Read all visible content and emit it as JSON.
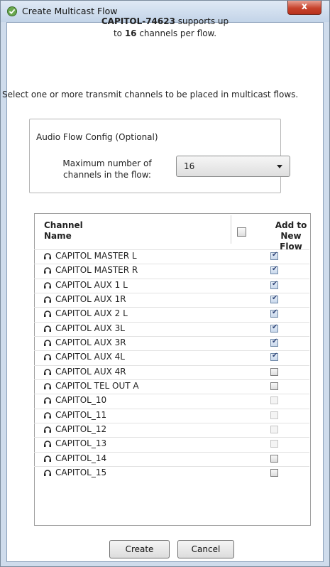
{
  "window": {
    "title": "Create Multicast Flow",
    "close_label": "x"
  },
  "header": {
    "device": "CAPITOL-74623",
    "line1_rest": " supports up",
    "line2_prefix": "to ",
    "max_channels": "16",
    "line2_suffix": " channels per flow."
  },
  "instruction": "Select one or more transmit channels to be placed in multicast flows.",
  "audio_flow_config": {
    "legend": "Audio Flow Config (Optional)",
    "max_label_line1": "Maximum number of",
    "max_label_line2": "channels in the flow:",
    "selected_value": "16"
  },
  "table": {
    "col_name_line1": "Channel",
    "col_name_line2": "Name",
    "col_add_line1": "Add to",
    "col_add_line2": "New Flow",
    "rows": [
      {
        "name": "CAPITOL MASTER L",
        "checked": true,
        "enabled": true
      },
      {
        "name": "CAPITOL MASTER R",
        "checked": true,
        "enabled": true
      },
      {
        "name": "CAPITOL AUX 1 L",
        "checked": true,
        "enabled": true
      },
      {
        "name": "CAPITOL AUX 1R",
        "checked": true,
        "enabled": true
      },
      {
        "name": "CAPITOL AUX 2 L",
        "checked": true,
        "enabled": true
      },
      {
        "name": "CAPITOL AUX 3L",
        "checked": true,
        "enabled": true
      },
      {
        "name": "CAPITOL AUX 3R",
        "checked": true,
        "enabled": true
      },
      {
        "name": "CAPITOL AUX 4L",
        "checked": true,
        "enabled": true
      },
      {
        "name": "CAPITOL AUX 4R",
        "checked": false,
        "enabled": true
      },
      {
        "name": "CAPITOL TEL OUT A",
        "checked": false,
        "enabled": true
      },
      {
        "name": "CAPITOL_10",
        "checked": false,
        "enabled": false
      },
      {
        "name": "CAPITOL_11",
        "checked": false,
        "enabled": false
      },
      {
        "name": "CAPITOL_12",
        "checked": false,
        "enabled": false
      },
      {
        "name": "CAPITOL_13",
        "checked": false,
        "enabled": false
      },
      {
        "name": "CAPITOL_14",
        "checked": false,
        "enabled": true
      },
      {
        "name": "CAPITOL_15",
        "checked": false,
        "enabled": true
      }
    ]
  },
  "buttons": {
    "create": "Create",
    "cancel": "Cancel"
  },
  "icons": {
    "app": "shield-check-icon",
    "row": "headphones-icon"
  },
  "colors": {
    "title_bg": "#cfdcec",
    "close_btn": "#c7432c"
  }
}
